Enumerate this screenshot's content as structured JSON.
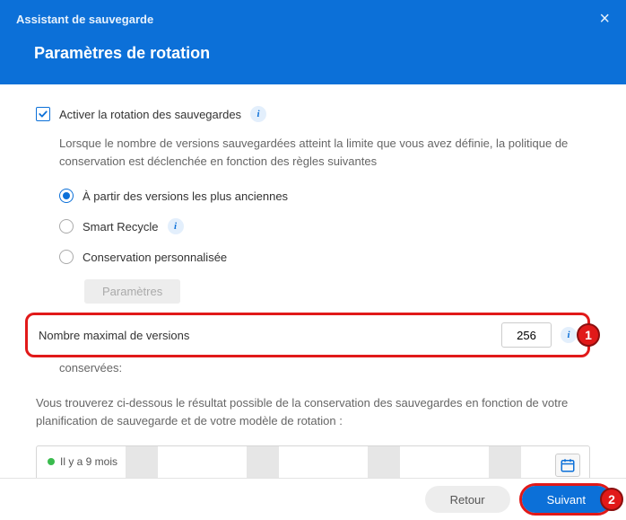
{
  "header": {
    "small_title": "Assistant de sauvegarde",
    "main_title": "Paramètres de rotation",
    "close_label": "×"
  },
  "enable_rotation": {
    "checked": true,
    "label": "Activer la rotation des sauvegardes"
  },
  "description": "Lorsque le nombre de versions sauvegardées atteint la limite que vous avez définie, la politique de conservation est déclenchée en fonction des règles suivantes",
  "policy": {
    "options": [
      {
        "label": "À partir des versions les plus anciennes",
        "checked": true,
        "has_info": false
      },
      {
        "label": "Smart Recycle",
        "checked": false,
        "has_info": true
      },
      {
        "label": "Conservation personnalisée",
        "checked": false,
        "has_info": false
      }
    ],
    "settings_button": "Paramètres",
    "settings_enabled": false
  },
  "max_versions": {
    "label": "Nombre maximal de versions",
    "value": "256",
    "conserved_suffix": "conservées:"
  },
  "result_intro": "Vous trouverez ci-dessous le résultat possible de la conservation des sauvegardes en fonction de votre planification de sauvegarde et de votre modèle de rotation :",
  "timeline": {
    "marker_label": "Il y a 9 mois"
  },
  "callouts": {
    "one": "1",
    "two": "2"
  },
  "footer": {
    "back": "Retour",
    "next": "Suivant"
  }
}
